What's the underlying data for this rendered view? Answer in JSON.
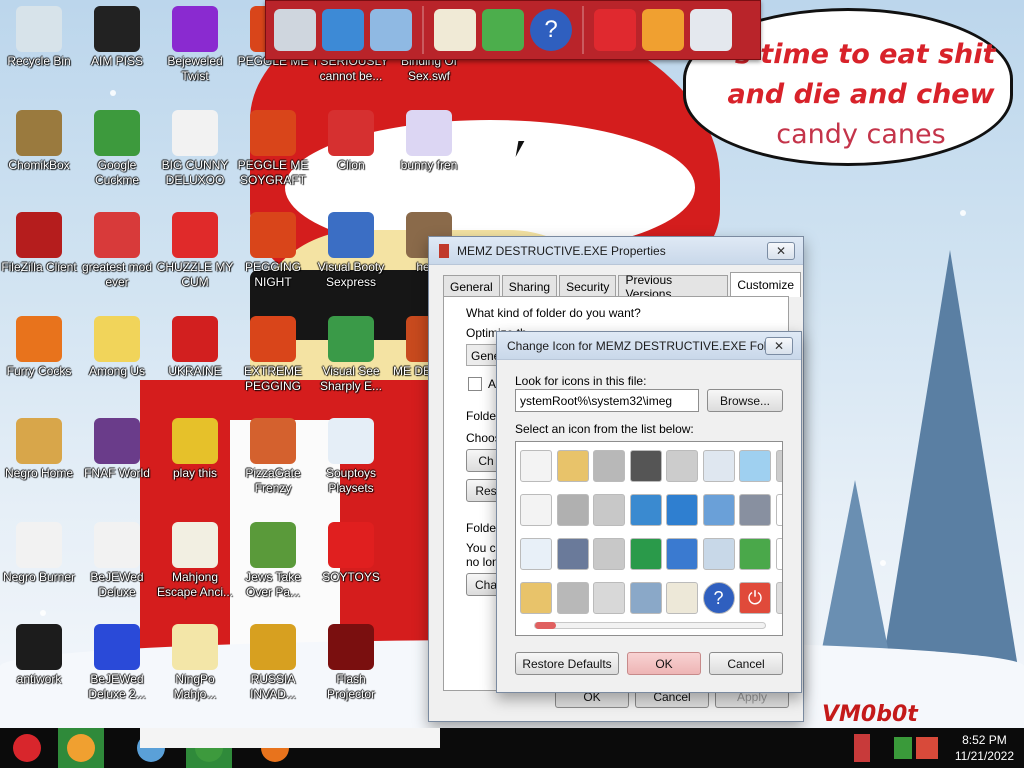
{
  "speech": {
    "line1": "'s time to eat shit",
    "line2": "and die and chew",
    "line3": "candy canes"
  },
  "signature": "VM0b0t",
  "desktop_icons": [
    {
      "label": "Recycle Bin",
      "icon": "recycle-bin-icon",
      "color": "#d7e3ea"
    },
    {
      "label": "AIM PISS",
      "icon": "aim-icon",
      "color": "#222222"
    },
    {
      "label": "Bejeweled Twist",
      "icon": "bejeweled-icon",
      "color": "#8a2ad0"
    },
    {
      "label": "PEGGLE ME",
      "icon": "peggle-icon",
      "color": "#d9451a"
    },
    {
      "label": "I SERIOUSLY cannot be...",
      "icon": "globe-icon",
      "color": "#3a8ad0"
    },
    {
      "label": "Binding Of Sex.swf",
      "icon": "flash-icon",
      "color": "#c91d1d"
    },
    {
      "label": "ChomikBox",
      "icon": "hamster-icon",
      "color": "#9a7a3e"
    },
    {
      "label": "Google Cuckme",
      "icon": "chrome-icon",
      "color": "#3d9a3d"
    },
    {
      "label": "BIG CUNNY DELUXOO",
      "icon": "document-icon",
      "color": "#f2f2f2"
    },
    {
      "label": "PEGGLE ME SOYGRAFT",
      "icon": "peggle-icon",
      "color": "#d9451a"
    },
    {
      "label": "Clion",
      "icon": "devcpp-icon",
      "color": "#d63030"
    },
    {
      "label": "bunny fren",
      "icon": "bunny-icon",
      "color": "#dcd6f3"
    },
    {
      "label": "FileZilla Client",
      "icon": "filezilla-icon",
      "color": "#b51d1d"
    },
    {
      "label": "greatest mod ever",
      "icon": "angry-bird-icon",
      "color": "#d83a3a"
    },
    {
      "label": "CHUZZLE MY CUM",
      "icon": "chuzzle-icon",
      "color": "#e02a2a"
    },
    {
      "label": "PEGGING NIGHT",
      "icon": "peggle-icon",
      "color": "#d9451a"
    },
    {
      "label": "Visual Booty Sexpress",
      "icon": "vb-icon",
      "color": "#3b6ec4"
    },
    {
      "label": "hello",
      "icon": "photo-icon",
      "color": "#8a6a4a"
    },
    {
      "label": "Furry Cocks",
      "icon": "firefox-icon",
      "color": "#e8731c"
    },
    {
      "label": "Among Us",
      "icon": "scanner-icon",
      "color": "#f1d45a"
    },
    {
      "label": "UKRAINE",
      "icon": "radiation-icon",
      "color": "#d21f1f"
    },
    {
      "label": "EXTREME PEGGING",
      "icon": "peggle-icon",
      "color": "#d9451a"
    },
    {
      "label": "Visual See Sharply E...",
      "icon": "csharp-icon",
      "color": "#3a9a48"
    },
    {
      "label": "ME DESTR...",
      "icon": "book-icon",
      "color": "#c84a1e"
    },
    {
      "label": "Negro Home",
      "icon": "home-icon",
      "color": "#d8a64a"
    },
    {
      "label": "FNAF World",
      "icon": "fnaf-icon",
      "color": "#6a3c8a"
    },
    {
      "label": "play this",
      "icon": "mahjong-icon",
      "color": "#e6c12a"
    },
    {
      "label": "PizzaGate Frenzy",
      "icon": "pizza-icon",
      "color": "#d4612e"
    },
    {
      "label": "Souptoys Playsets",
      "icon": "window-icon",
      "color": "#e5eef7"
    },
    {
      "label": "Negro Burner",
      "icon": "document-icon",
      "color": "#f2f2f2"
    },
    {
      "label": "BeJEWed Deluxe",
      "icon": "document-icon",
      "color": "#f2f2f2"
    },
    {
      "label": "Mahjong Escape Anci...",
      "icon": "torii-icon",
      "color": "#f2efe2"
    },
    {
      "label": "Jews Take Over Pa...",
      "icon": "zombie-plant-icon",
      "color": "#5a9a3a"
    },
    {
      "label": "SOYTOYS",
      "icon": "s-logo-icon",
      "color": "#e01f1f"
    },
    {
      "label": "antiwork",
      "icon": "spider-icon",
      "color": "#1c1c1c"
    },
    {
      "label": "BeJEWed Deluxe 2...",
      "icon": "bejeweled2-icon",
      "color": "#2a4ad8"
    },
    {
      "label": "NingPo Mahjo...",
      "icon": "ningpo-icon",
      "color": "#f3e6a8"
    },
    {
      "label": "RUSSIA INVAD...",
      "icon": "zuma-icon",
      "color": "#d7a020"
    },
    {
      "label": "Flash Projector",
      "icon": "flash-icon",
      "color": "#7a0f0f"
    }
  ],
  "toolbar": [
    {
      "icon": "santa-computer-icon",
      "color": "#cfd6de"
    },
    {
      "icon": "globe-network-icon",
      "color": "#3d8ad6"
    },
    {
      "icon": "control-panel-icon",
      "color": "#8fb9e3"
    },
    {
      "icon": "snowman-icon",
      "color": "#f0ead6"
    },
    {
      "icon": "windows-update-icon",
      "color": "#4cae4c"
    },
    {
      "icon": "help-icon",
      "color": "#2f5fbf"
    },
    {
      "icon": "gift-icon",
      "color": "#e0292f"
    },
    {
      "icon": "folder-icon",
      "color": "#f0a030"
    },
    {
      "icon": "recycle-bin-icon",
      "color": "#e4e8ee"
    }
  ],
  "properties_dialog": {
    "title": "MEMZ DESTRUCTIVE.EXE Properties",
    "tabs": [
      "General",
      "Sharing",
      "Security",
      "Previous Versions",
      "Customize"
    ],
    "question": "What kind of folder do you want?",
    "optimize_label": "Optimize this folder for:",
    "optimize_value": "Gene",
    "also_label": "Als",
    "folder_pictures_header": "Folder",
    "choose_label": "Choos",
    "choose_btn": "Ch",
    "restore_btn": "Res",
    "folder_icons_header": "Folder",
    "you_can_label": "You ca",
    "no_longer_label": "no lon",
    "change_btn": "Cha",
    "ok_label": "OK",
    "cancel_label": "Cancel",
    "apply_label": "Apply"
  },
  "change_icon_dialog": {
    "title": "Change Icon for MEMZ DESTRUCTIVE.EXE Fol...",
    "look_label": "Look for icons in this file:",
    "file_value": "ystemRoot%\\system32\\imeg",
    "browse_label": "Browse...",
    "select_label": "Select an icon from the list below:",
    "restore_label": "Restore Defaults",
    "ok_label": "OK",
    "cancel_label": "Cancel",
    "scroll_fraction": 0.09,
    "icons": [
      [
        {
          "icon": "window-small-icon",
          "c": "#f3f3f3"
        },
        {
          "icon": "folder-icon",
          "c": "#e8c36a"
        },
        {
          "icon": "drive-icon",
          "c": "#b8b8b8"
        },
        {
          "icon": "chip-icon",
          "c": "#555555"
        },
        {
          "icon": "printer-icon",
          "c": "#cccccc"
        },
        {
          "icon": "clock-icon",
          "c": "#dfe7f0"
        },
        {
          "icon": "monitor-icon",
          "c": "#9fd0f0"
        },
        {
          "icon": "partial-icon",
          "c": "#cccccc"
        }
      ],
      [
        {
          "icon": "text-document-icon",
          "c": "#f3f3f3"
        },
        {
          "icon": "network-drive-icon",
          "c": "#b0b0b0"
        },
        {
          "icon": "network-share-icon",
          "c": "#c8c8c8"
        },
        {
          "icon": "globe-icon",
          "c": "#3a8ad0"
        },
        {
          "icon": "network-globe-icon",
          "c": "#2f7fd0"
        },
        {
          "icon": "control-panel-icon",
          "c": "#6aa0d8"
        },
        {
          "icon": "speaker-icon",
          "c": "#8890a0"
        },
        {
          "icon": "shortcut-icon",
          "c": "#ffffff"
        }
      ],
      [
        {
          "icon": "window-blank-icon",
          "c": "#e8f0f8"
        },
        {
          "icon": "floppy-icon",
          "c": "#6a7a9a"
        },
        {
          "icon": "drive-error-icon",
          "c": "#c8c8c8"
        },
        {
          "icon": "mouse-globe-icon",
          "c": "#2a9a4a"
        },
        {
          "icon": "network-icon",
          "c": "#3a7ad0"
        },
        {
          "icon": "magnifier-icon",
          "c": "#c8d8e8"
        },
        {
          "icon": "arrow-drive-icon",
          "c": "#4aa84a"
        },
        {
          "icon": "cd-icon",
          "c": "#ffffff"
        }
      ],
      [
        {
          "icon": "folder-open-icon",
          "c": "#e8c36a"
        },
        {
          "icon": "hard-drive-icon",
          "c": "#b8b8b8"
        },
        {
          "icon": "cd-drive-icon",
          "c": "#d8d8d8"
        },
        {
          "icon": "computer-icon",
          "c": "#8aa8c8"
        },
        {
          "icon": "calculator-icon",
          "c": "#ede8d8"
        },
        {
          "icon": "help-icon",
          "c": "#2f5fbf"
        },
        {
          "icon": "power-icon",
          "c": "#e04a3a"
        },
        {
          "icon": "partial-icon",
          "c": "#dddddd"
        }
      ]
    ]
  },
  "taskbar": {
    "items": [
      {
        "icon": "santa-start-icon",
        "color": "#d8262c"
      },
      {
        "icon": "folder-taskbar-icon",
        "color": "#f0a030"
      },
      {
        "icon": "media-player-icon",
        "color": "#5aa0d8"
      },
      {
        "icon": "chrome-taskbar-icon",
        "color": "#3d9a3d"
      },
      {
        "icon": "firefox-taskbar-icon",
        "color": "#e8731c"
      }
    ],
    "time": "8:52 PM",
    "date": "11/21/2022"
  }
}
